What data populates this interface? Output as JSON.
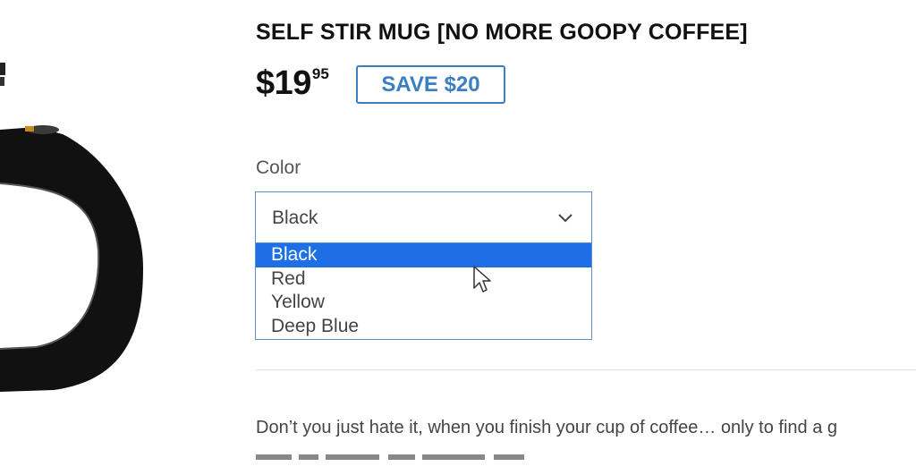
{
  "product": {
    "title": "SELF STIR MUG [NO MORE GOOPY COFFEE]",
    "price_main": "$19",
    "price_cents": "95",
    "save_badge": "SAVE $20"
  },
  "color_select": {
    "label": "Color",
    "selected_value": "Black",
    "options": [
      "Black",
      "Red",
      "Yellow",
      "Deep Blue"
    ],
    "highlighted_index": 0
  },
  "description": {
    "text": "Don’t you just hate it, when you finish your cup of coffee… only to find a g"
  },
  "icons": {
    "dropdown_chevron": "chevron-down-icon",
    "cursor": "mouse-pointer-icon"
  },
  "colors": {
    "accent": "#3a7fc4",
    "option_highlight": "#1e6fe6",
    "select_border": "#5a8fd0"
  }
}
